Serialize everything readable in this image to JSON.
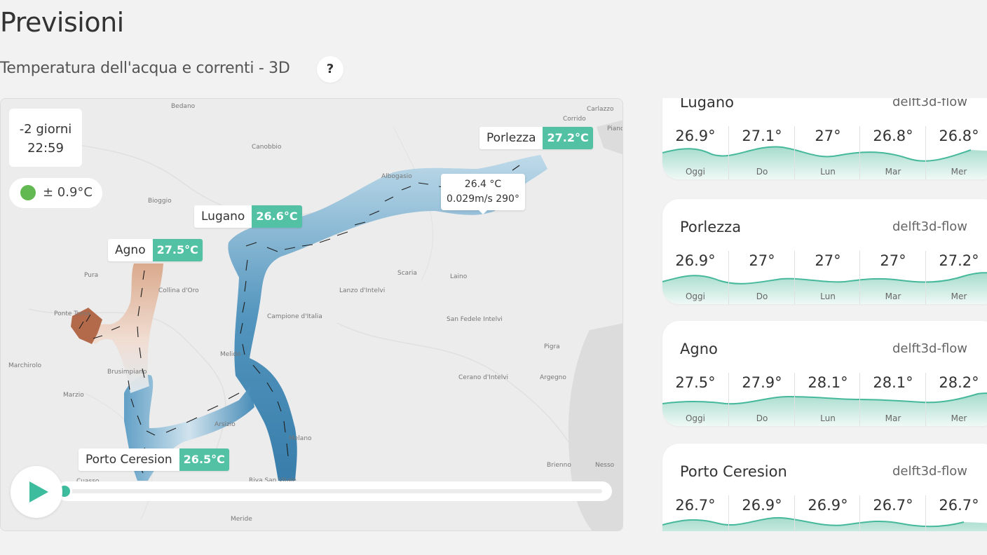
{
  "page": {
    "title": "Previsioni",
    "subtitle": "Temperatura dell'acqua e correnti - 3D",
    "help_label": "?"
  },
  "map": {
    "time_offset": "-2 giorni",
    "time": "22:59",
    "accuracy": "± 0.9°C",
    "accuracy_color": "#62b851",
    "tooltip": {
      "temperature": "26.4 °C",
      "current": "0.029m/s 290°"
    },
    "markers": [
      {
        "name": "Porlezza",
        "temp": "27.2°C"
      },
      {
        "name": "Lugano",
        "temp": "26.6°C"
      },
      {
        "name": "Agno",
        "temp": "27.5°C"
      },
      {
        "name": "Porto Ceresion",
        "temp": "26.5°C"
      }
    ],
    "place_labels": [
      "Bedano",
      "Corrido",
      "Carlazzo",
      "Piano",
      "Canobbio",
      "Bioggio",
      "Albogasio",
      "Pura",
      "Collina d'Oro",
      "Scaria",
      "Laino",
      "Lanzo d'Intelvi",
      "Ponte Tresa",
      "Campione d'Italia",
      "San Fedele Intelvi",
      "Pigra",
      "Marchirolo",
      "Melide",
      "Brusimpiano",
      "Marzio",
      "Cerano d'Intelvi",
      "Argegno",
      "Arsizio",
      "Melano",
      "Brienno",
      "Nesso",
      "Riva San Vitale",
      "Meride",
      "Cuasso"
    ],
    "colors": {
      "water_cold": "#3b86b0",
      "water_warm": "#c98a6a",
      "accent": "#3dbd9e",
      "marker_temp_bg": "#52c1a4"
    }
  },
  "player": {
    "progress": 0.0
  },
  "forecast": {
    "day_labels": [
      "Oggi",
      "Do",
      "Lun",
      "Mar",
      "Mer"
    ],
    "stations": [
      {
        "name": "Lugano",
        "model": "delft3d-flow",
        "temps": [
          "26.9°",
          "27.1°",
          "27°",
          "26.8°",
          "26.8°"
        ]
      },
      {
        "name": "Porlezza",
        "model": "delft3d-flow",
        "temps": [
          "26.9°",
          "27°",
          "27°",
          "27°",
          "27.2°"
        ]
      },
      {
        "name": "Agno",
        "model": "delft3d-flow",
        "temps": [
          "27.5°",
          "27.9°",
          "28.1°",
          "28.1°",
          "28.2°"
        ]
      },
      {
        "name": "Porto Ceresion",
        "model": "delft3d-flow",
        "temps": [
          "26.7°",
          "26.9°",
          "26.9°",
          "26.7°",
          "26.7°"
        ]
      }
    ]
  }
}
